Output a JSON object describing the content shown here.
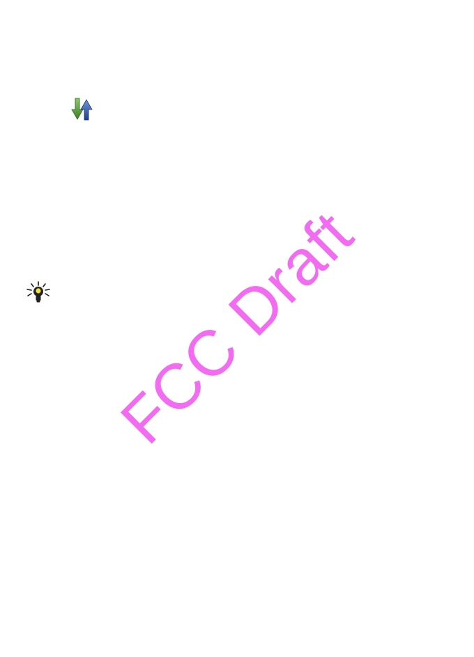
{
  "watermark": {
    "text": "FCC Draft",
    "color": "#f26cf2"
  },
  "icons": {
    "data_transfer": "download-upload-arrows-icon",
    "tip": "lightbulb-tip-icon"
  },
  "colors": {
    "background": "#ffffff",
    "arrow_down": "#5a9a3c",
    "arrow_up": "#2e5aa8"
  }
}
